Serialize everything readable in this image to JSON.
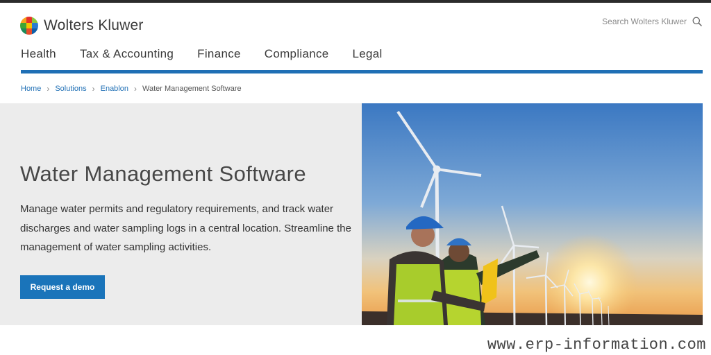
{
  "brand": {
    "name": "Wolters Kluwer",
    "colors": {
      "accent": "#1f6fb5",
      "button": "#1a74ba",
      "hero_bg": "#ececec"
    }
  },
  "search": {
    "placeholder": "Search Wolters Kluwer",
    "icon": "search-icon"
  },
  "nav": {
    "items": [
      {
        "label": "Health"
      },
      {
        "label": "Tax & Accounting"
      },
      {
        "label": "Finance"
      },
      {
        "label": "Compliance"
      },
      {
        "label": "Legal"
      }
    ]
  },
  "breadcrumb": {
    "links": [
      {
        "label": "Home"
      },
      {
        "label": "Solutions"
      },
      {
        "label": "Enablon"
      }
    ],
    "current": "Water Management Software",
    "separator_icon": "chevron-right-icon"
  },
  "hero": {
    "title": "Water Management Software",
    "description": "Manage water permits and regulatory requirements, and track water discharges and water sampling logs in a central location. Streamline the management of water sampling activities.",
    "cta_label": "Request a demo"
  },
  "watermark": "www.erp-information.com"
}
